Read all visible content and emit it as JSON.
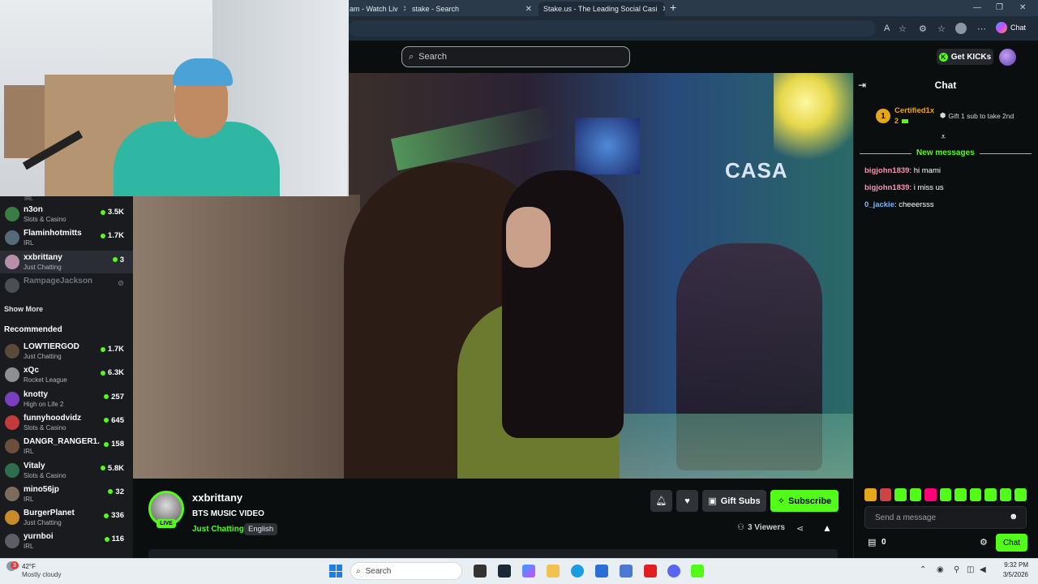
{
  "browser": {
    "tabs": [
      {
        "label": "am - Watch Liv",
        "close": "✕"
      },
      {
        "label": "stake - Search",
        "close": "✕"
      },
      {
        "label": "Stake.us - The Leading Social Casi",
        "close": "✕"
      }
    ],
    "new_tab": "+",
    "copilot_label": "Chat"
  },
  "header": {
    "search_placeholder": "Search",
    "get_kicks_label": "Get KICKs"
  },
  "sidebar": {
    "irl_tag": "IRL",
    "following": [
      {
        "name": "n3on",
        "category": "Slots & Casino",
        "viewers": "3.5K",
        "color": "#3a7d44"
      },
      {
        "name": "Flaminhotmitts",
        "category": "IRL",
        "viewers": "1.7K",
        "color": "#556b7a"
      },
      {
        "name": "xxbrittany",
        "category": "Just Chatting",
        "viewers": "3",
        "color": "#b88fa8"
      },
      {
        "name": "RampageJackson",
        "category": "",
        "viewers": "",
        "color": "#4a4f55"
      }
    ],
    "show_more": "Show More",
    "recommended_title": "Recommended",
    "recommended": [
      {
        "name": "LOWTIERGOD",
        "category": "Just Chatting",
        "viewers": "1.7K",
        "color": "#5a4a3a"
      },
      {
        "name": "xQc",
        "category": "Rocket League",
        "viewers": "6.3K",
        "color": "#8d8f93"
      },
      {
        "name": "knotty",
        "category": "High on Life 2",
        "viewers": "257",
        "color": "#7a3fbf"
      },
      {
        "name": "funnyhoodvidz",
        "category": "Slots & Casino",
        "viewers": "645",
        "color": "#c23a3a"
      },
      {
        "name": "DANGR_RANGER1...",
        "category": "IRL",
        "viewers": "158",
        "color": "#6b4f3a"
      },
      {
        "name": "Vitaly",
        "category": "Slots & Casino",
        "viewers": "5.8K",
        "color": "#2f6d4f"
      },
      {
        "name": "mino56jp",
        "category": "IRL",
        "viewers": "32",
        "color": "#7b6c5d"
      },
      {
        "name": "BurgerPlanet",
        "category": "Just Chatting",
        "viewers": "336",
        "color": "#c98a2b"
      },
      {
        "name": "yurnboi",
        "category": "IRL",
        "viewers": "116",
        "color": "#5d5d66"
      }
    ]
  },
  "video": {
    "sign_text": "CASA"
  },
  "stream": {
    "name": "xxbrittany",
    "title": "BTS MUSIC VIDEO",
    "category": "Just Chatting",
    "language": "English",
    "live_label": "LIVE",
    "gift_subs_label": "Gift Subs",
    "subscribe_label": "Subscribe",
    "viewers_label": "3 Viewers"
  },
  "chat": {
    "title": "Chat",
    "leader": {
      "rank": "1",
      "name": "Certified1x",
      "count": "2"
    },
    "gift_prompt": "Gift 1 sub to take 2nd",
    "new_messages_label": "New messages",
    "messages": [
      {
        "user": "bigjohn1839",
        "text": "hi mami",
        "color": "#ff8fb0"
      },
      {
        "user": "bigjohn1839",
        "text": "i miss us",
        "color": "#ff8fb0"
      },
      {
        "user": "0_jackie",
        "text": "cheeersss",
        "color": "#7ab8ff"
      }
    ],
    "input_placeholder": "Send a message",
    "kicks_count": "0",
    "send_label": "Chat",
    "emote_colors": [
      "#e6a619",
      "#c44",
      "#53fc18",
      "#53fc18",
      "#f07",
      "#53fc18",
      "#53fc18",
      "#53fc18",
      "#53fc18",
      "#53fc18",
      "#53fc18"
    ]
  },
  "taskbar": {
    "weather_temp": "42°F",
    "weather_desc": "Mostly cloudy",
    "weather_badge": "3",
    "search_label": "Search",
    "time": "9:32 PM",
    "date": "3/5/2026"
  }
}
